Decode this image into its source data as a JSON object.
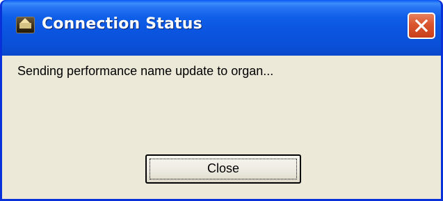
{
  "window": {
    "title": "Connection Status",
    "app_icon": "organ-house-icon",
    "close_icon": "close-icon"
  },
  "dialog": {
    "message": "Sending performance name update to organ...",
    "close_button_label": "Close"
  },
  "colors": {
    "titlebar": "#0a55e0",
    "close_button": "#d9542c",
    "client_background": "#ece9d8"
  }
}
